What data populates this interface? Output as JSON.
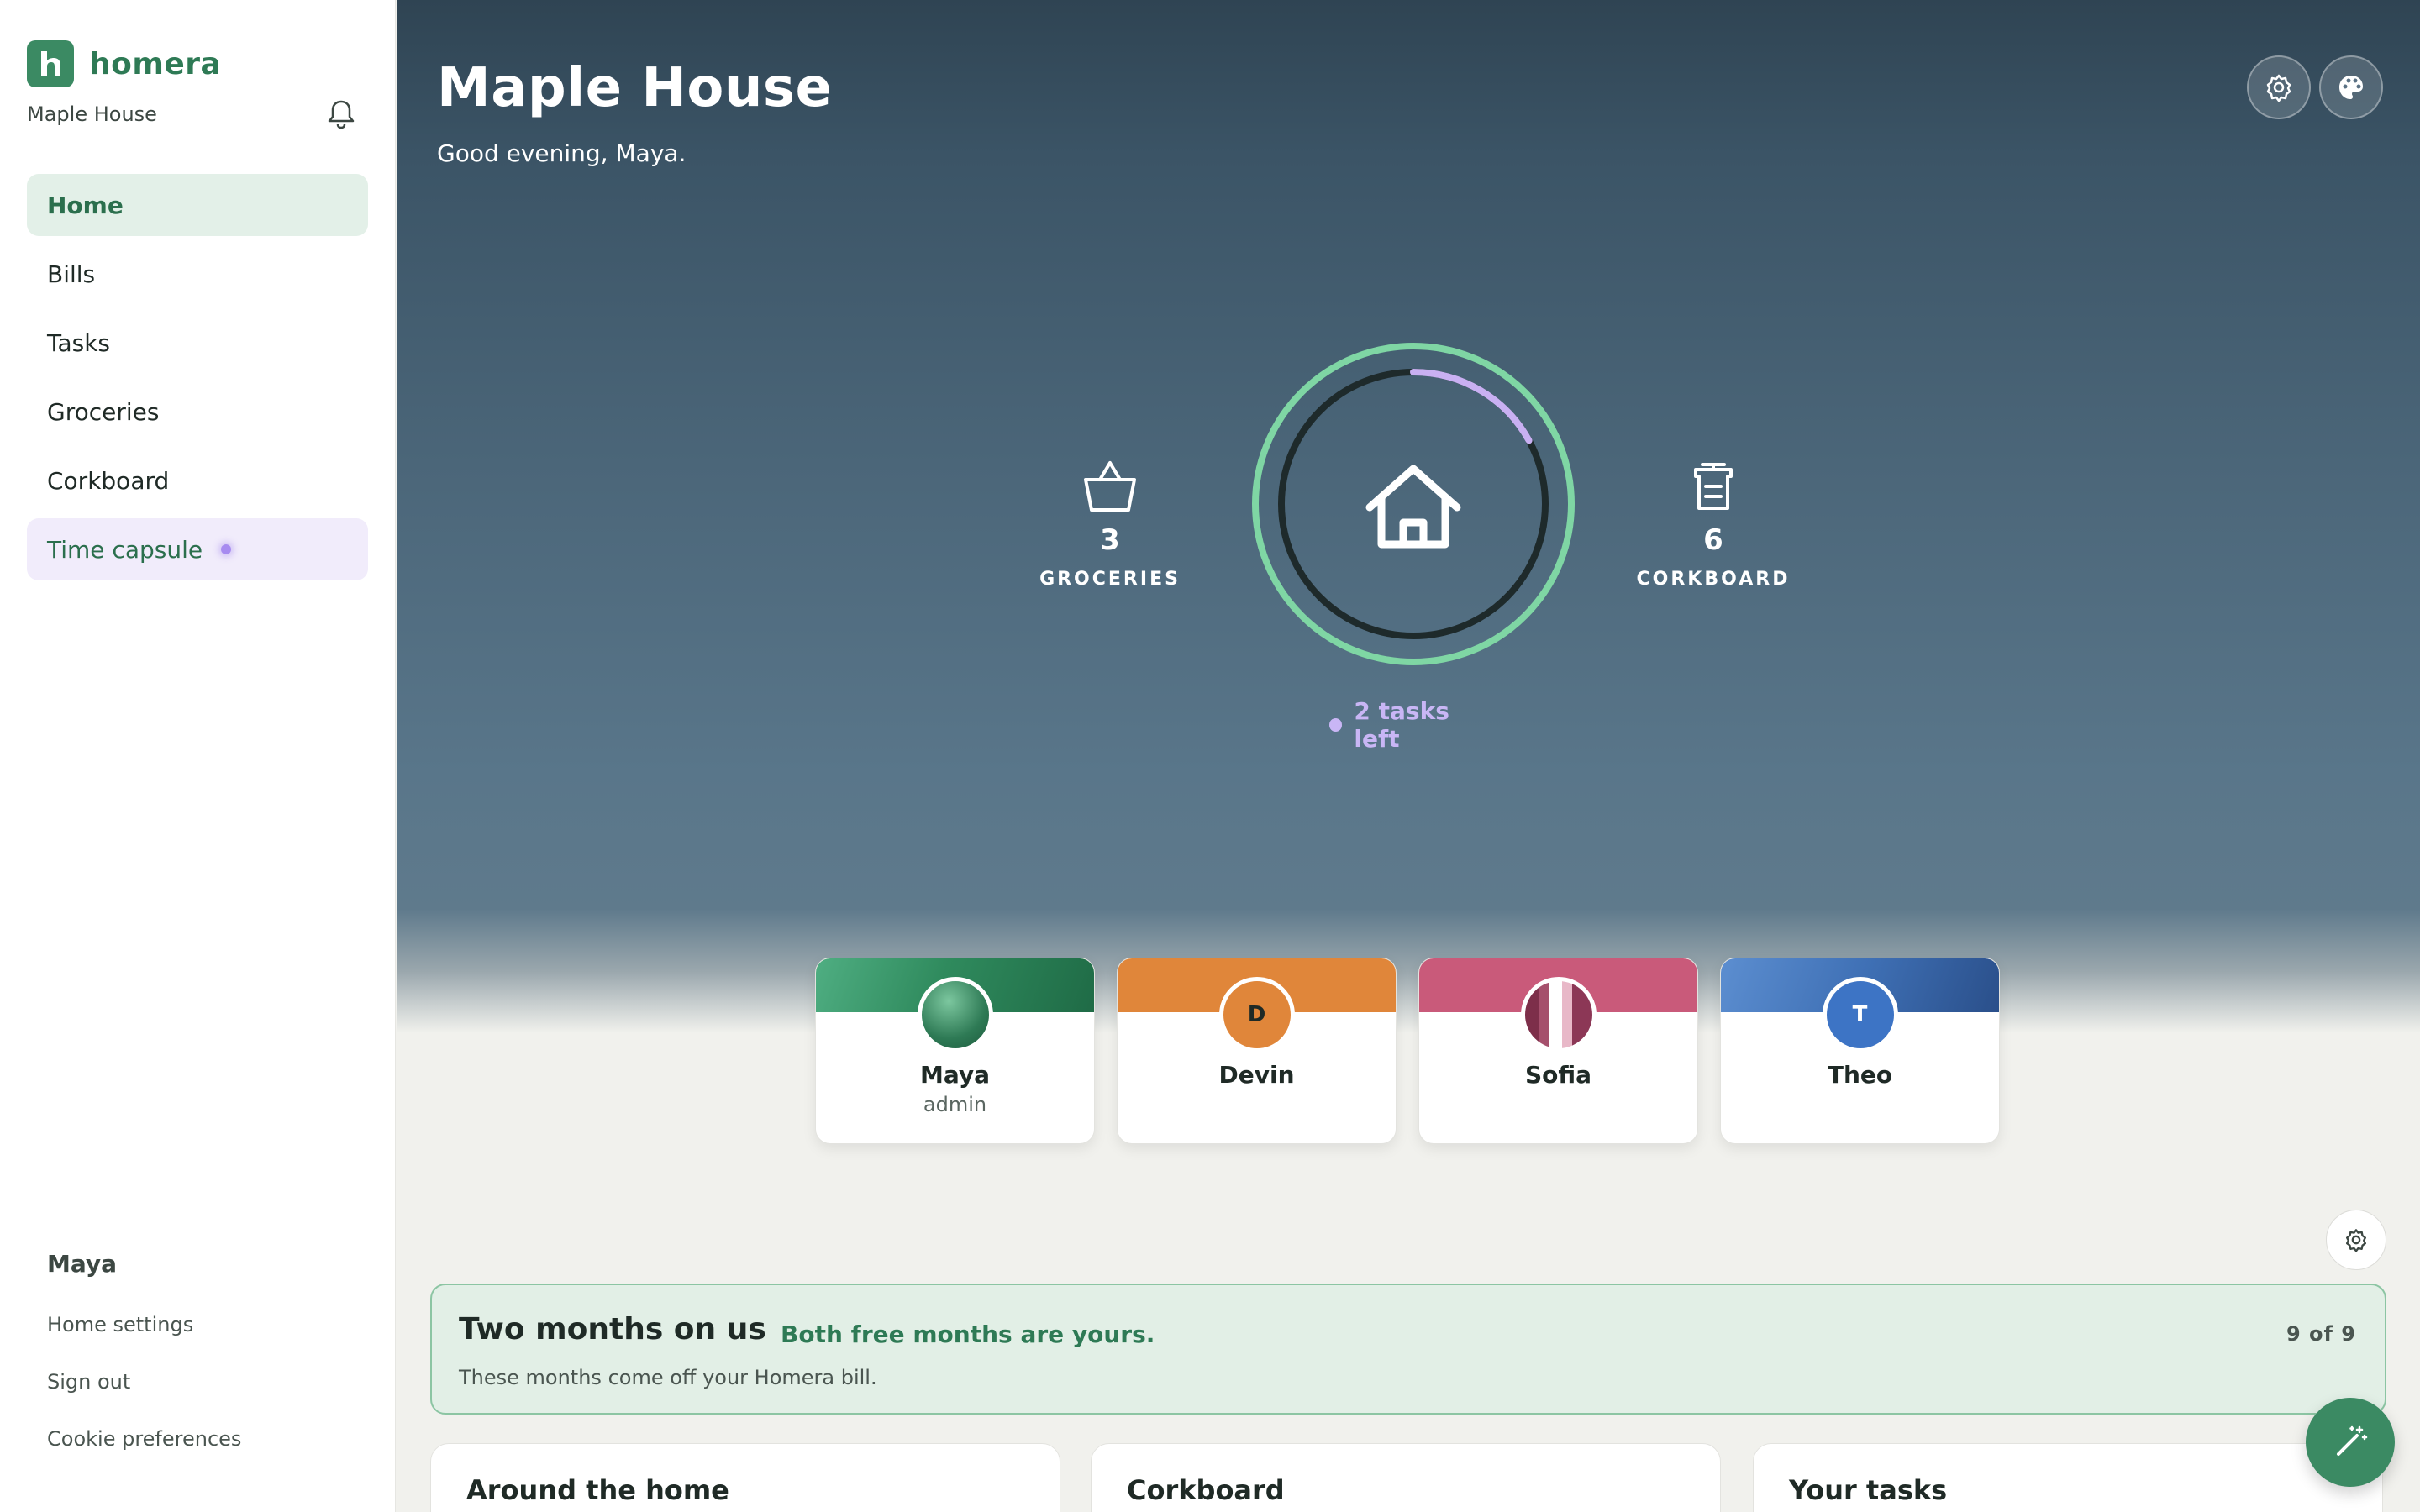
{
  "brand": {
    "name": "homera",
    "logo_letter": "h"
  },
  "sidebar": {
    "house_name": "Maple House",
    "nav": [
      {
        "label": "Home"
      },
      {
        "label": "Bills"
      },
      {
        "label": "Tasks"
      },
      {
        "label": "Groceries"
      },
      {
        "label": "Corkboard"
      },
      {
        "label": "Time capsule"
      }
    ],
    "user_name": "Maya",
    "links": [
      {
        "label": "Home settings"
      },
      {
        "label": "Sign out"
      },
      {
        "label": "Cookie preferences"
      }
    ]
  },
  "hero": {
    "title": "Maple House",
    "greeting": "Good evening, Maya.",
    "stats": [
      {
        "count": "3",
        "label": "GROCERIES",
        "icon": "basket-icon"
      },
      {
        "count": "6",
        "label": "CORKBOARD",
        "icon": "clipboard-icon"
      }
    ],
    "tasks_left": "2 tasks left",
    "task_progress_fraction": 0.17
  },
  "members": [
    {
      "name": "Maya",
      "role": "admin",
      "initial": ""
    },
    {
      "name": "Devin",
      "role": "",
      "initial": "D"
    },
    {
      "name": "Sofia",
      "role": "",
      "initial": ""
    },
    {
      "name": "Theo",
      "role": "",
      "initial": "T"
    }
  ],
  "promo": {
    "title": "Two months on us",
    "subtitle": "Both free months are yours.",
    "description": "These months come off your Homera bill.",
    "count": "9 of 9"
  },
  "cards": [
    {
      "title": "Around the home"
    },
    {
      "title": "Corkboard"
    },
    {
      "title": "Your tasks"
    }
  ],
  "colors": {
    "brand_green": "#3b8a63",
    "accent_purple": "#a78bf0",
    "ring_green": "#7fd6a4"
  }
}
